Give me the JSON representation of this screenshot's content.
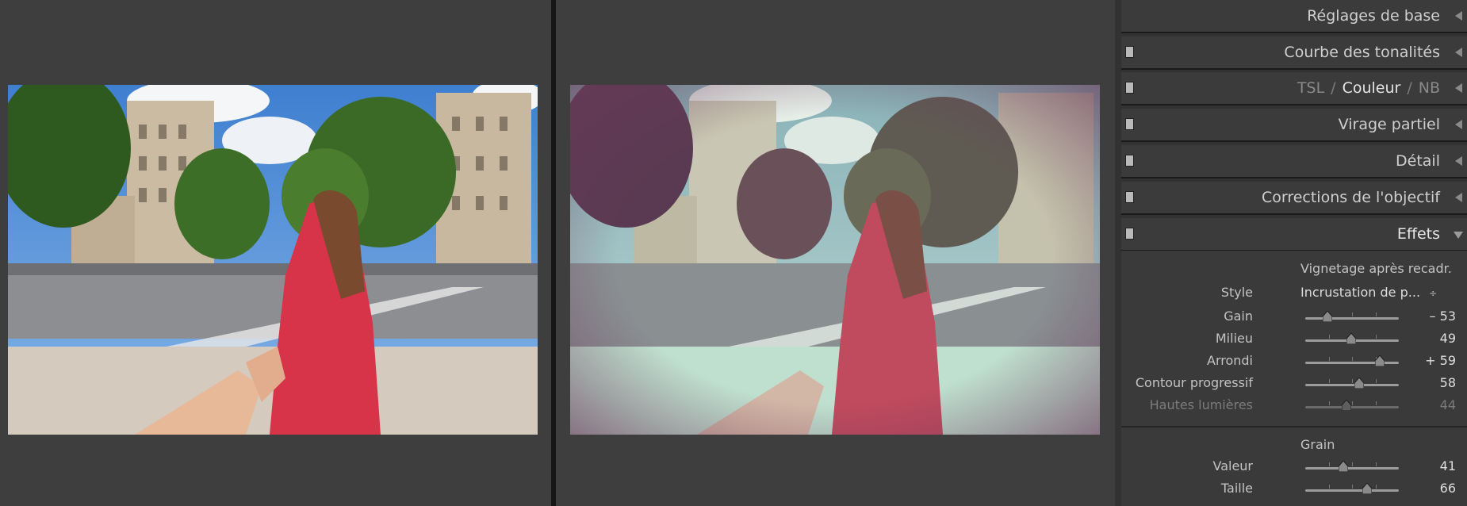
{
  "panels": {
    "basic": {
      "title": "Réglages de base"
    },
    "tone_curve": {
      "title": "Courbe des tonalités"
    },
    "hsl": {
      "tabs": [
        "TSL",
        "Couleur",
        "NB"
      ],
      "sep": "/"
    },
    "split_toning": {
      "title": "Virage partiel"
    },
    "detail": {
      "title": "Détail"
    },
    "lens": {
      "title": "Corrections de l'objectif"
    },
    "effects": {
      "title": "Effets",
      "vignette": {
        "title": "Vignetage après recadr.",
        "style_label": "Style",
        "style_value": "Incrustation de p...",
        "style_arrows": "÷",
        "sliders": [
          {
            "label": "Gain",
            "display": "– 53",
            "value": -53,
            "min": -100,
            "max": 100
          },
          {
            "label": "Milieu",
            "display": "49",
            "value": 49,
            "min": 0,
            "max": 100
          },
          {
            "label": "Arrondi",
            "display": "+ 59",
            "value": 59,
            "min": -100,
            "max": 100
          },
          {
            "label": "Contour progressif",
            "display": "58",
            "value": 58,
            "min": 0,
            "max": 100
          },
          {
            "label": "Hautes lumières",
            "display": "44",
            "value": 44,
            "min": 0,
            "max": 100,
            "disabled": true
          }
        ]
      },
      "grain": {
        "title": "Grain",
        "sliders": [
          {
            "label": "Valeur",
            "display": "41",
            "value": 41,
            "min": 0,
            "max": 100
          },
          {
            "label": "Taille",
            "display": "66",
            "value": 66,
            "min": 0,
            "max": 100
          }
        ]
      }
    }
  },
  "colors": {
    "panel_bg": "#323232",
    "header_bg": "#3b3b3b",
    "text": "#cfcfcf",
    "image_pane": "#3e3e3e"
  }
}
